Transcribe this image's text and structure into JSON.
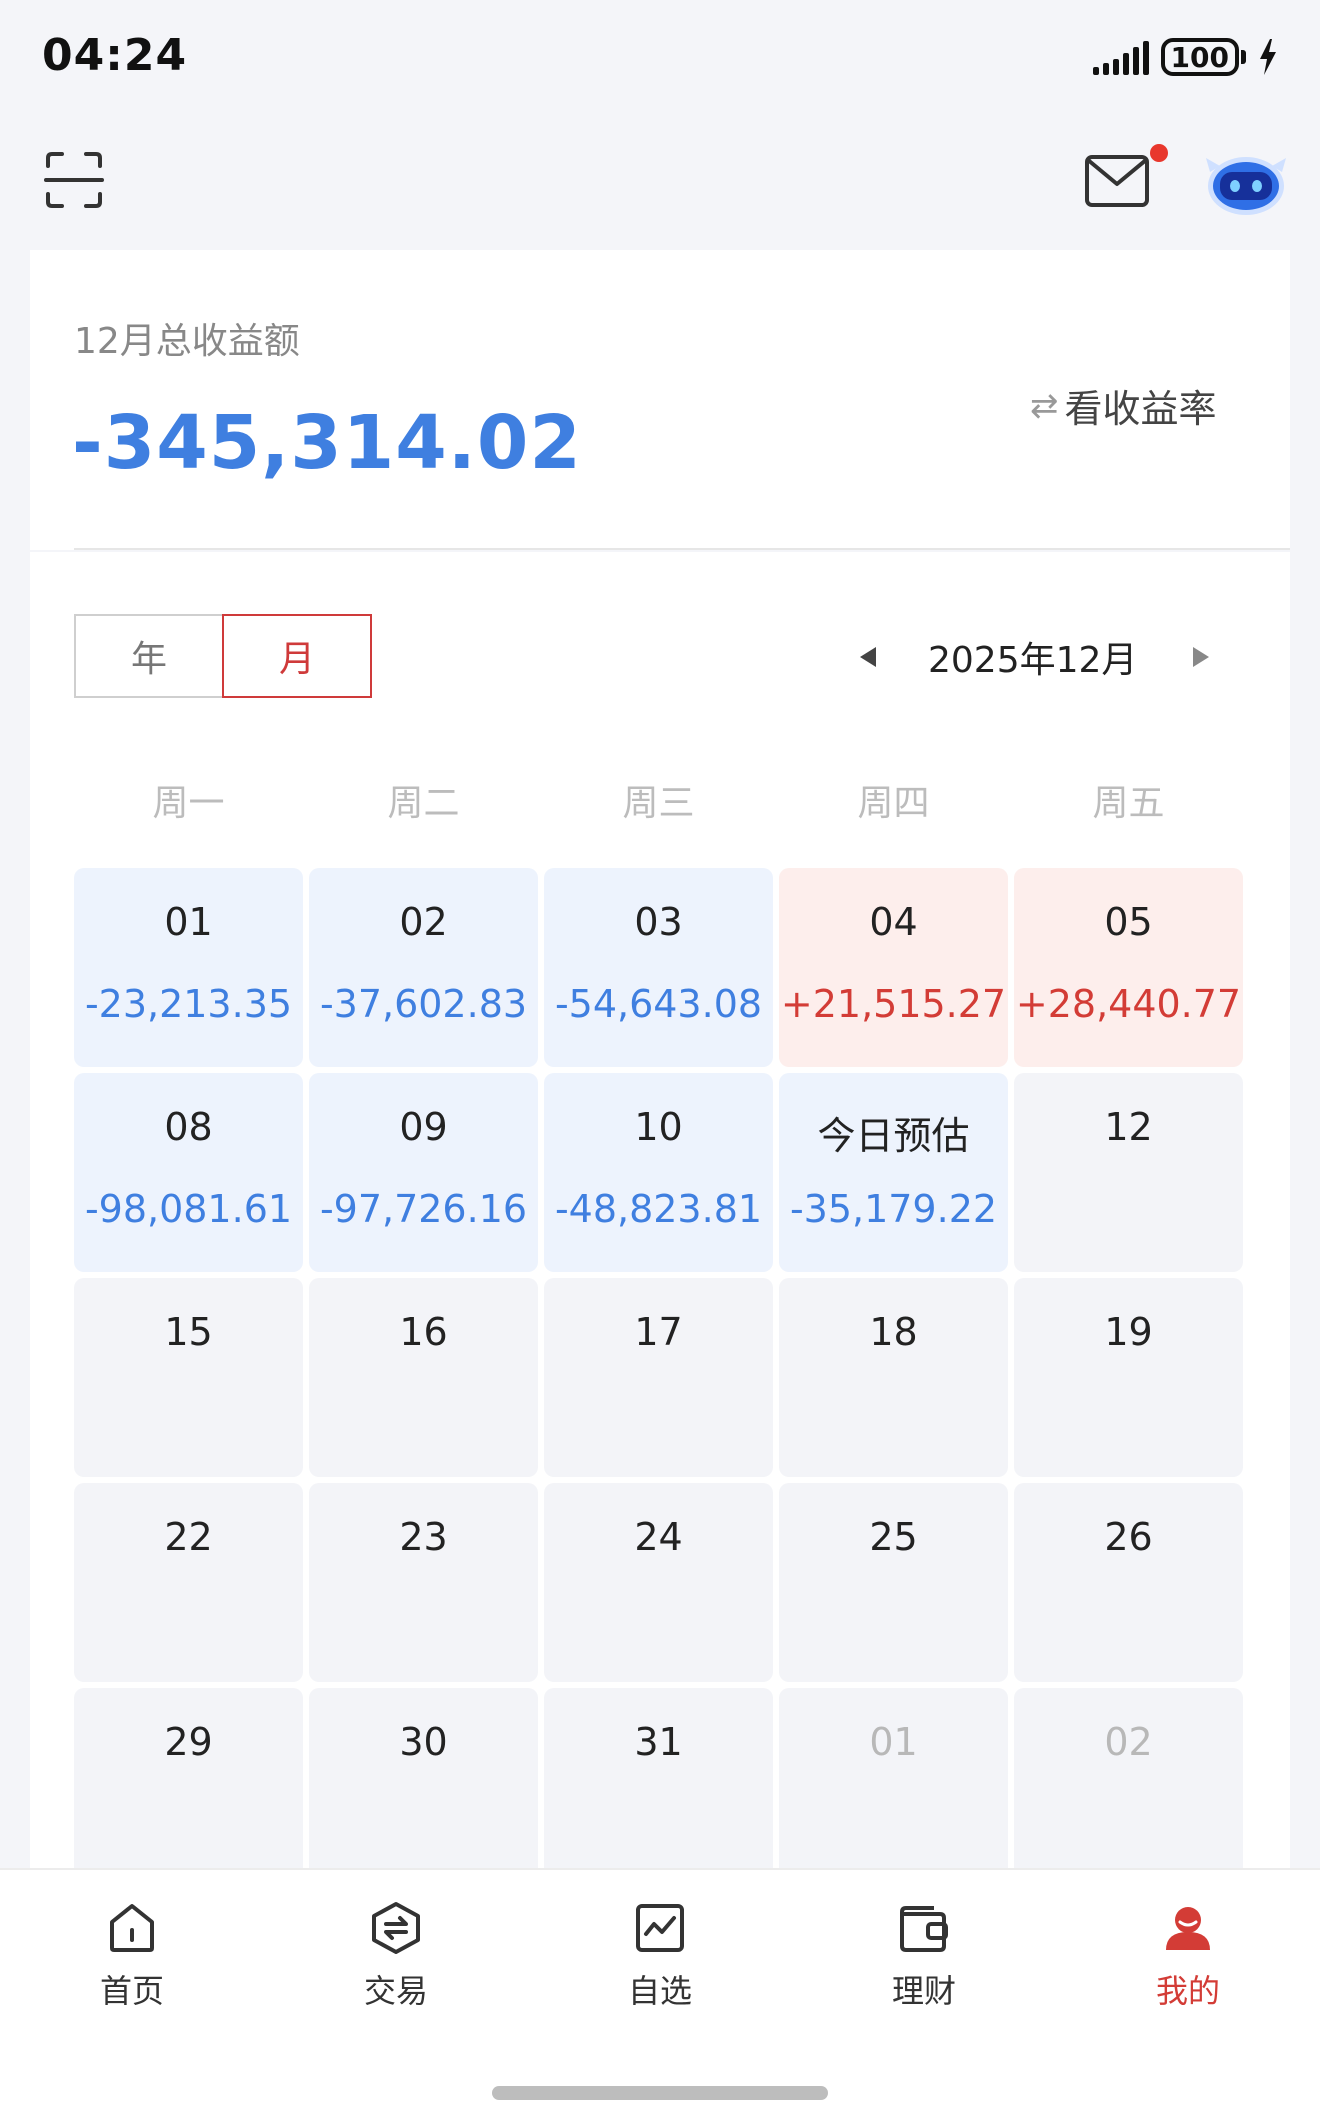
{
  "status_bar": {
    "time": "04:24",
    "battery": "100",
    "icons": [
      "signal-icon",
      "battery-icon",
      "charging-icon"
    ]
  },
  "header": {
    "icons": [
      "scan-icon",
      "mail-icon",
      "robot-assistant-icon"
    ],
    "mail_badge_color": "#e8372d"
  },
  "summary": {
    "label": "12月总收益额",
    "value": "-345,314.02",
    "toggle_label": "看收益率",
    "value_color": "#3f7fe0"
  },
  "calendar": {
    "segments": [
      "年",
      "月"
    ],
    "selected_segment": "月",
    "month_label": "2025年12月",
    "weekdays": [
      "周一",
      "周二",
      "周三",
      "周四",
      "周五"
    ],
    "cells": [
      {
        "day": "01",
        "amount": "-23,213.35",
        "type": "loss"
      },
      {
        "day": "02",
        "amount": "-37,602.83",
        "type": "loss"
      },
      {
        "day": "03",
        "amount": "-54,643.08",
        "type": "loss"
      },
      {
        "day": "04",
        "amount": "+21,515.27",
        "type": "gain"
      },
      {
        "day": "05",
        "amount": "+28,440.77",
        "type": "gain"
      },
      {
        "day": "08",
        "amount": "-98,081.61",
        "type": "loss"
      },
      {
        "day": "09",
        "amount": "-97,726.16",
        "type": "loss"
      },
      {
        "day": "10",
        "amount": "-48,823.81",
        "type": "loss"
      },
      {
        "day": "今日预估",
        "amount": "-35,179.22",
        "type": "loss"
      },
      {
        "day": "12",
        "amount": "",
        "type": "none"
      },
      {
        "day": "15",
        "amount": "",
        "type": "none"
      },
      {
        "day": "16",
        "amount": "",
        "type": "none"
      },
      {
        "day": "17",
        "amount": "",
        "type": "none"
      },
      {
        "day": "18",
        "amount": "",
        "type": "none"
      },
      {
        "day": "19",
        "amount": "",
        "type": "none"
      },
      {
        "day": "22",
        "amount": "",
        "type": "none"
      },
      {
        "day": "23",
        "amount": "",
        "type": "none"
      },
      {
        "day": "24",
        "amount": "",
        "type": "none"
      },
      {
        "day": "25",
        "amount": "",
        "type": "none"
      },
      {
        "day": "26",
        "amount": "",
        "type": "none"
      },
      {
        "day": "29",
        "amount": "",
        "type": "none"
      },
      {
        "day": "30",
        "amount": "",
        "type": "none"
      },
      {
        "day": "31",
        "amount": "",
        "type": "none"
      },
      {
        "day": "01",
        "amount": "",
        "type": "muted"
      },
      {
        "day": "02",
        "amount": "",
        "type": "muted"
      }
    ],
    "colors": {
      "gain": "#d33c36",
      "loss": "#3f7fe0"
    }
  },
  "bottom_nav": {
    "items": [
      {
        "label": "首页",
        "icon": "home-icon"
      },
      {
        "label": "交易",
        "icon": "trade-icon"
      },
      {
        "label": "自选",
        "icon": "watchlist-icon"
      },
      {
        "label": "理财",
        "icon": "wallet-icon"
      },
      {
        "label": "我的",
        "icon": "profile-icon"
      }
    ],
    "active": "我的",
    "active_color": "#d33c36"
  }
}
